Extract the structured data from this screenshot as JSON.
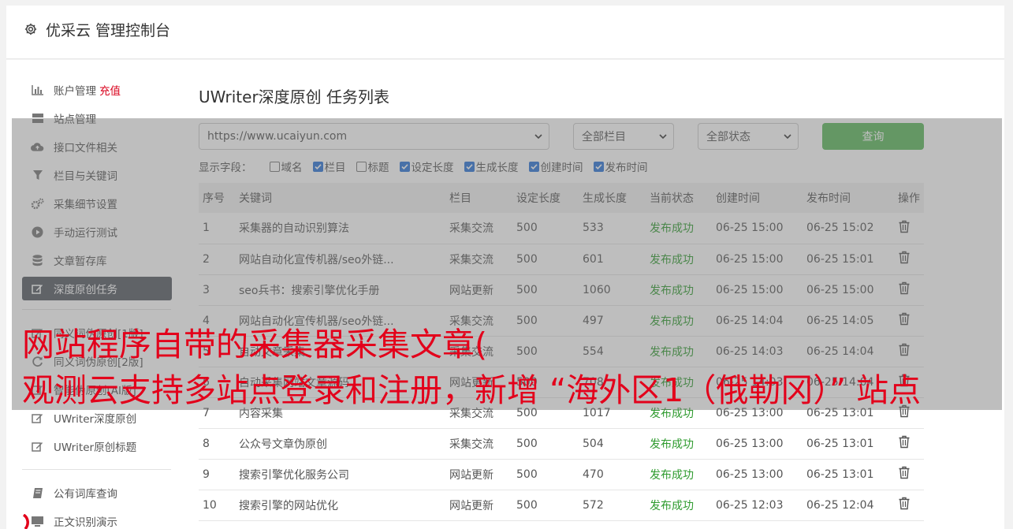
{
  "header": {
    "title": "优采云 管理控制台",
    "icon": "gear-icon"
  },
  "sidebar": {
    "items": [
      {
        "label": "账户管理",
        "tag": "充值",
        "icon": "bar-chart-icon"
      },
      {
        "label": "站点管理",
        "icon": "server-icon"
      },
      {
        "label": "接口文件相关",
        "icon": "cloud-upload-icon"
      },
      {
        "label": "栏目与关键词",
        "icon": "filter-icon"
      },
      {
        "label": "采集细节设置",
        "icon": "gears-icon"
      },
      {
        "label": "手动运行测试",
        "icon": "play-circle-icon"
      },
      {
        "label": "文章暂存库",
        "icon": "database-icon"
      },
      {
        "label": "深度原创任务",
        "icon": "edit-icon",
        "active": true
      },
      {
        "label": "同义词伪原创[1版]",
        "icon": "edit-icon"
      },
      {
        "label": "同义词伪原创[2版]",
        "icon": "refresh-icon"
      },
      {
        "label": "智能伪原创[AI版]",
        "icon": "edit-icon"
      },
      {
        "label": "UWriter深度原创",
        "icon": "edit-icon"
      },
      {
        "label": "UWriter原创标题",
        "icon": "edit-icon"
      },
      {
        "label": "公有词库查询",
        "icon": "book-icon"
      },
      {
        "label": "正文识别演示",
        "icon": "monitor-icon"
      }
    ]
  },
  "main": {
    "title": "UWriter深度原创 任务列表",
    "site_select": "https://www.ucaiyun.com",
    "column_select": "全部栏目",
    "status_select": "全部状态",
    "query_button": "查询",
    "fields_label": "显示字段：",
    "fields": [
      {
        "label": "域名",
        "checked": false
      },
      {
        "label": "栏目",
        "checked": true
      },
      {
        "label": "标题",
        "checked": false
      },
      {
        "label": "设定长度",
        "checked": true
      },
      {
        "label": "生成长度",
        "checked": true
      },
      {
        "label": "创建时间",
        "checked": true
      },
      {
        "label": "发布时间",
        "checked": true
      }
    ],
    "table": {
      "headers": [
        "序号",
        "关键词",
        "栏目",
        "设定长度",
        "生成长度",
        "当前状态",
        "创建时间",
        "发布时间",
        "操作"
      ],
      "rows": [
        [
          "1",
          "采集器的自动识别算法",
          "采集交流",
          "500",
          "533",
          "发布成功",
          "06-25 15:00",
          "06-25 15:02"
        ],
        [
          "2",
          "网站自动化宣传机器/seo外链...",
          "采集交流",
          "500",
          "601",
          "发布成功",
          "06-25 15:00",
          "06-25 15:01"
        ],
        [
          "3",
          "seo兵书：搜索引擎优化手册",
          "网站更新",
          "500",
          "1060",
          "发布成功",
          "06-25 15:00",
          "06-25 15:00"
        ],
        [
          "4",
          "网站自动化宣传机器/seo外链...",
          "采集交流",
          "500",
          "497",
          "发布成功",
          "06-25 14:04",
          "06-25 14:05"
        ],
        [
          "5",
          "自动文章采集",
          "采集交流",
          "500",
          "554",
          "发布成功",
          "06-25 14:03",
          "06-25 14:04"
        ],
        [
          "6",
          "自动采集网站文章源码",
          "网站更新",
          "500",
          "708",
          "发布成功",
          "06-25 14:03",
          "06-25 14:04"
        ],
        [
          "7",
          "内容采集",
          "采集交流",
          "500",
          "1017",
          "发布成功",
          "06-25 13:00",
          "06-25 13:01"
        ],
        [
          "8",
          "公众号文章伪原创",
          "采集交流",
          "500",
          "504",
          "发布成功",
          "06-25 13:00",
          "06-25 13:01"
        ],
        [
          "9",
          "搜索引擎优化服务公司",
          "网站更新",
          "500",
          "470",
          "发布成功",
          "06-25 13:00",
          "06-25 13:01"
        ],
        [
          "10",
          "搜索引擎的网站优化",
          "网站更新",
          "500",
          "572",
          "发布成功",
          "06-25 12:03",
          "06-25 12:04"
        ]
      ]
    }
  },
  "banner": {
    "line1": "网站程序自带的采集器采集文章(",
    "line2": "观测云支持多站点登录和注册，新增 “海外区1（俄勒冈）” 站点"
  },
  "colors": {
    "status_ok": "#2e9b2e",
    "query_button": "#5cb85c",
    "banner": "#e3001b",
    "active_item": "#555a62"
  }
}
